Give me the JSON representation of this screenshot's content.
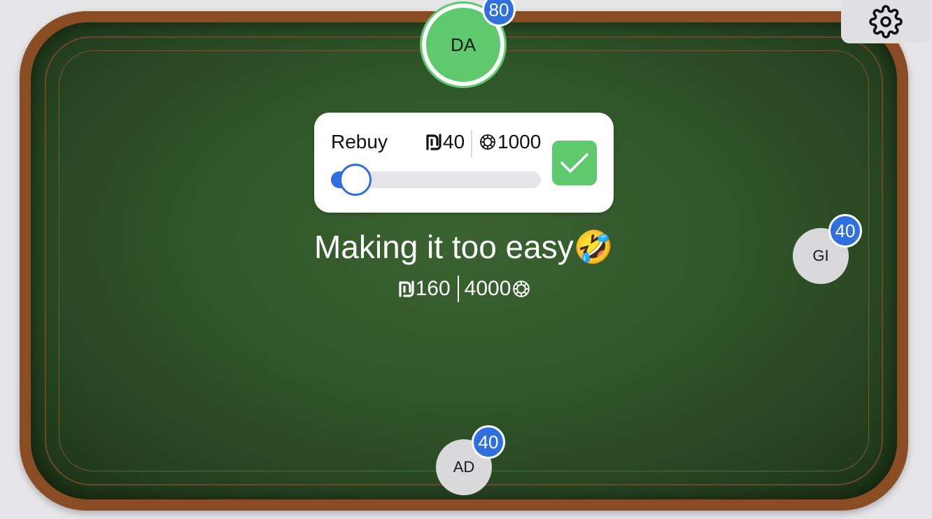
{
  "settings": {
    "icon": "gear-icon"
  },
  "seats": {
    "top": {
      "initials": "DA",
      "badge": "80",
      "active": true
    },
    "right": {
      "initials": "GI",
      "badge": "40",
      "active": false
    },
    "bottom": {
      "initials": "AD",
      "badge": "40",
      "active": false
    }
  },
  "rebuy": {
    "label": "Rebuy",
    "money_amount": "40",
    "chip_amount": "1000",
    "slider_level": 0,
    "confirm_icon": "checkmark-icon"
  },
  "table": {
    "message": "Making it too easy🤣",
    "money_total": "160",
    "chip_total": "4000"
  },
  "colors": {
    "felt": "#30552a",
    "rail": "#8a4c22",
    "accent_blue": "#2f6fe0",
    "active_green": "#5fc96e",
    "seat_gray": "#d9d9dc"
  }
}
